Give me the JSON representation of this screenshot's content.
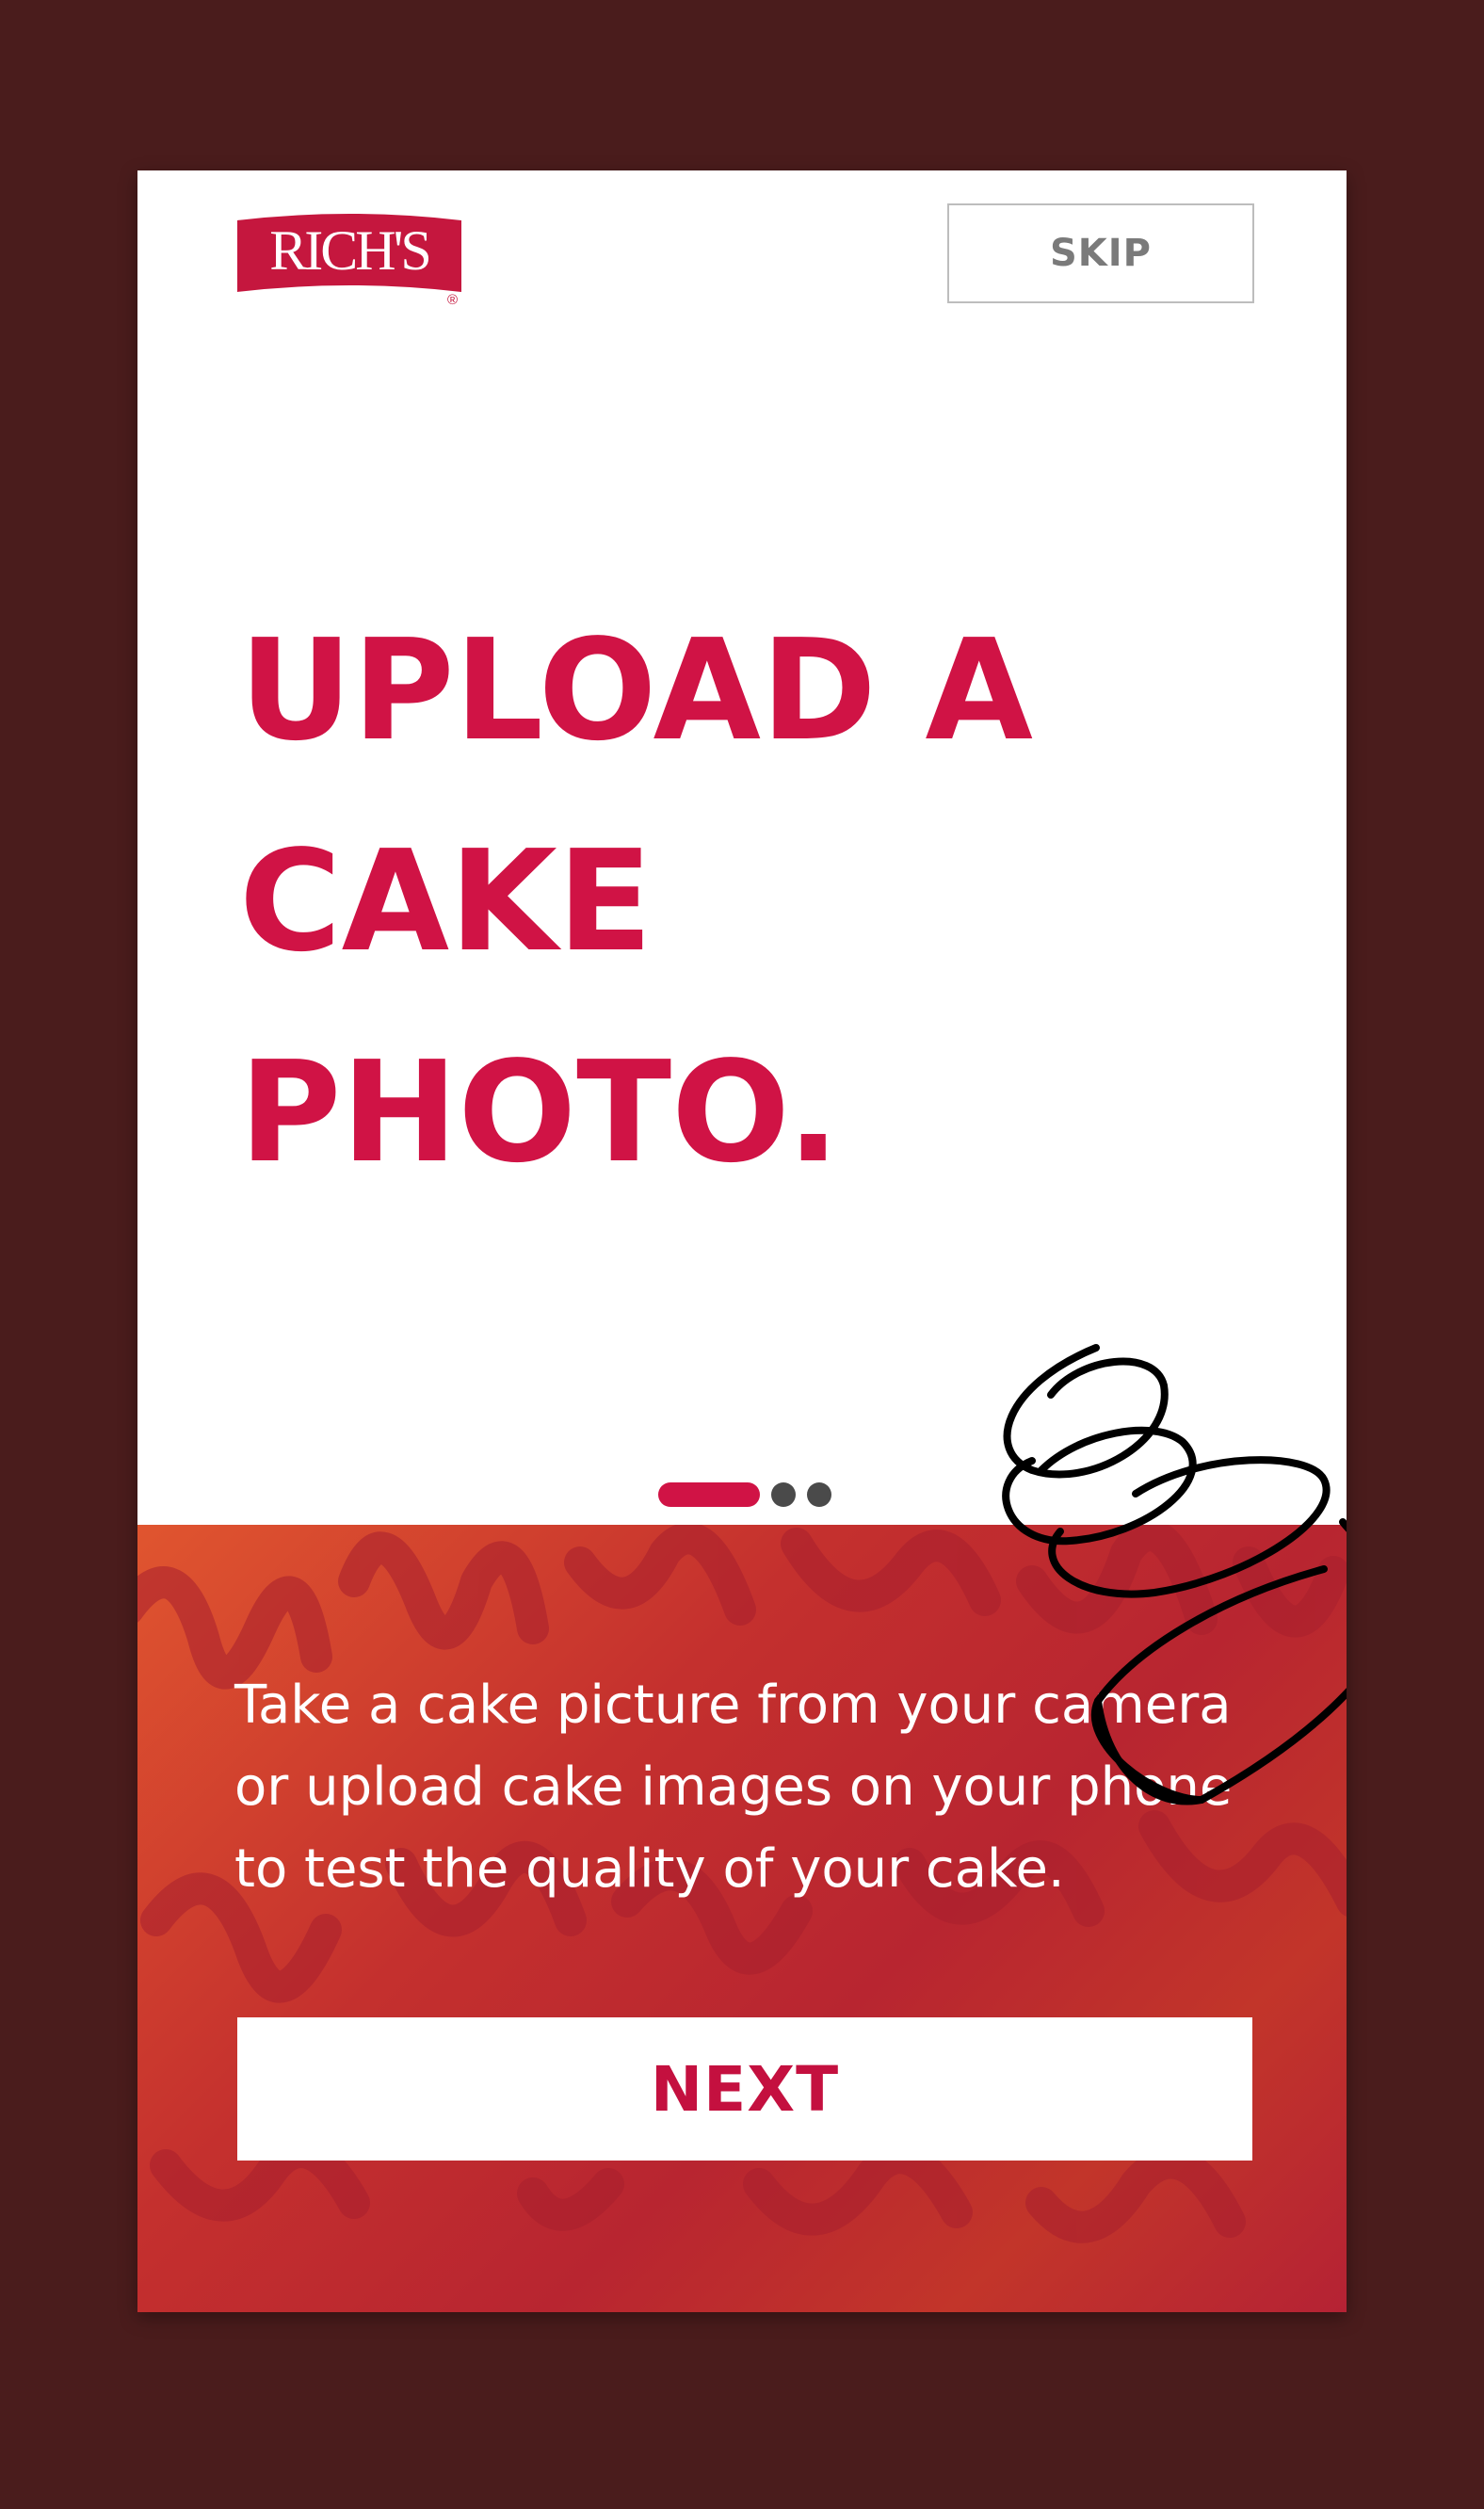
{
  "brand": {
    "logo_text": "RICH'S",
    "registered_mark": "®"
  },
  "header": {
    "skip_label": "SKIP"
  },
  "headline": {
    "lines": [
      "UPLOAD A",
      "CAKE",
      "PHOTO."
    ]
  },
  "pager": {
    "total": 3,
    "active_index": 0
  },
  "onboarding": {
    "description": "Take a cake picture from your camera or upload cake images on your phone to test the quality of your cake.",
    "next_label": "NEXT"
  },
  "colors": {
    "accent": "#d01345",
    "background": "#4a1c1c",
    "panel_gradient_start": "#e0552f",
    "panel_gradient_end": "#b52234"
  },
  "icons": {
    "cake": "cake-outline-icon"
  }
}
